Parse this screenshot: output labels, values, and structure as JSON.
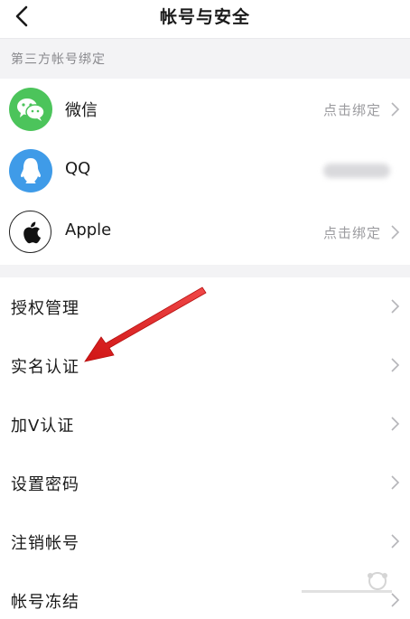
{
  "header": {
    "title": "帐号与安全"
  },
  "third_party": {
    "section_title": "第三方帐号绑定",
    "items": [
      {
        "label": "微信",
        "status": "点击绑定",
        "icon": "wechat-icon",
        "color": "#4cc45b"
      },
      {
        "label": "QQ",
        "status": "",
        "icon": "qq-icon",
        "color": "#3f9be8"
      },
      {
        "label": "Apple",
        "status": "点击绑定",
        "icon": "apple-icon",
        "color": "#000000"
      }
    ]
  },
  "menu": {
    "items": [
      {
        "label": "授权管理"
      },
      {
        "label": "实名认证"
      },
      {
        "label": "加V认证"
      },
      {
        "label": "设置密码"
      },
      {
        "label": "注销帐号"
      },
      {
        "label": "帐号冻结"
      }
    ]
  },
  "annotation": {
    "color": "#e11d1d"
  }
}
